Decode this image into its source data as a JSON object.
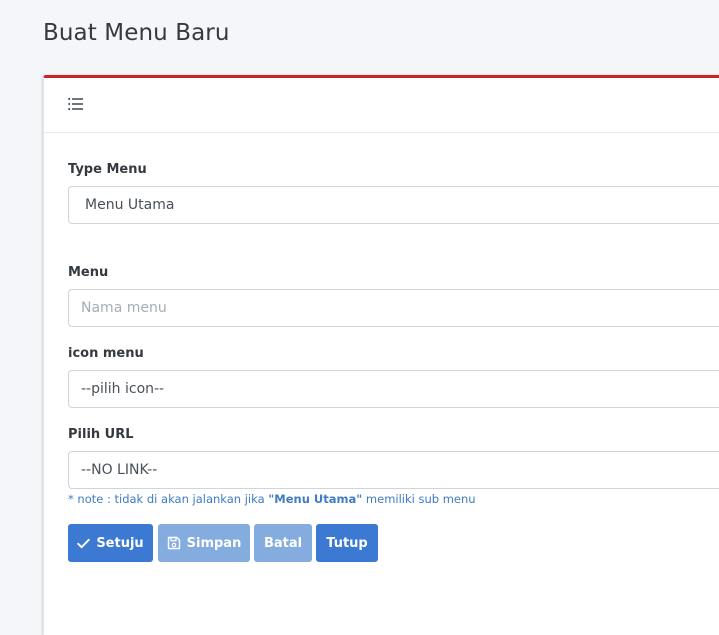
{
  "page": {
    "title": "Buat Menu Baru"
  },
  "form": {
    "type_menu": {
      "label": "Type Menu",
      "value": "Menu Utama"
    },
    "menu": {
      "label": "Menu",
      "placeholder": "Nama menu"
    },
    "icon_menu": {
      "label": "icon menu",
      "value": "--pilih icon--"
    },
    "pilih_url": {
      "label": "Pilih URL",
      "value": "--NO LINK--"
    },
    "note": {
      "prefix": "* note : tidak di akan jalankan jika ",
      "quote_open": "\"",
      "highlight": "Menu Utama",
      "quote_close": "\"",
      "suffix": " memiliki sub menu"
    }
  },
  "buttons": {
    "setuju": "Setuju",
    "simpan": "Simpan",
    "batal": "Batal",
    "tutup": "Tutup"
  },
  "colors": {
    "accent_border": "#c6262e",
    "primary": "#3b79d3",
    "primary_disabled": "#85acde",
    "note_text": "#3f7cc4"
  },
  "icons": {
    "header": "list-icon",
    "setuju": "check-icon",
    "simpan": "save-icon"
  }
}
